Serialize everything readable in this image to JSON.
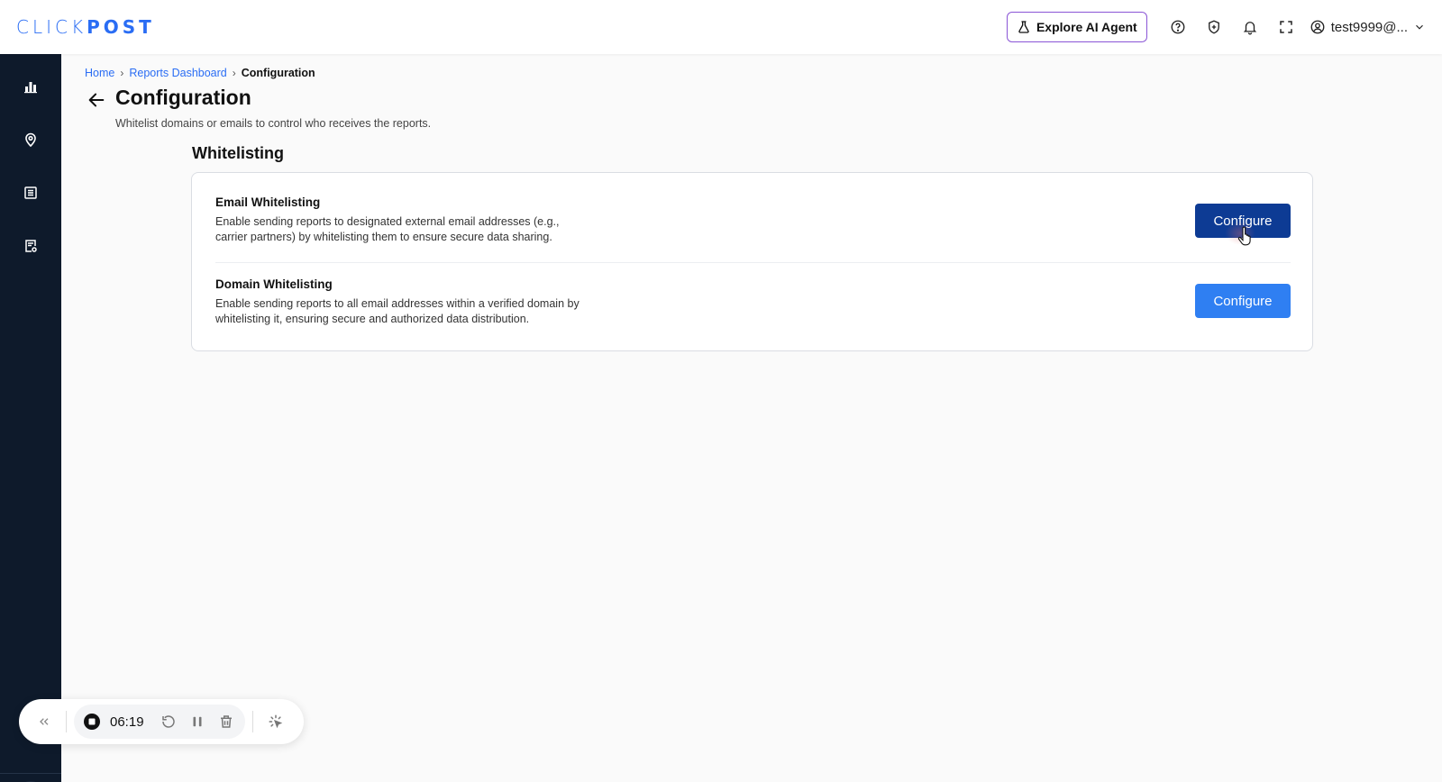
{
  "brand": {
    "logo_light": "CLICK",
    "logo_bold": "POST"
  },
  "header": {
    "ai_agent_label": "Explore AI Agent",
    "user_label": "test9999@..."
  },
  "breadcrumb": {
    "items": [
      "Home",
      "Reports Dashboard",
      "Configuration"
    ]
  },
  "page": {
    "title": "Configuration",
    "subtitle": "Whitelist domains or emails to control who receives the reports."
  },
  "section": {
    "title": "Whitelisting",
    "rows": [
      {
        "title": "Email Whitelisting",
        "description": "Enable sending reports to designated external email addresses (e.g., carrier partners) by whitelisting them to ensure secure data sharing.",
        "button_label": "Configure"
      },
      {
        "title": "Domain Whitelisting",
        "description": "Enable sending reports to all email addresses within a verified domain by whitelisting it, ensuring secure and authorized data distribution.",
        "button_label": "Configure"
      }
    ]
  },
  "recorder": {
    "time": "06:19"
  },
  "colors": {
    "accent": "#2a6df4",
    "sidebar": "#0e1a2b",
    "button_primary": "#0d3b94",
    "button_secondary": "#2f7ff2",
    "ai_border": "#8a55d6"
  }
}
